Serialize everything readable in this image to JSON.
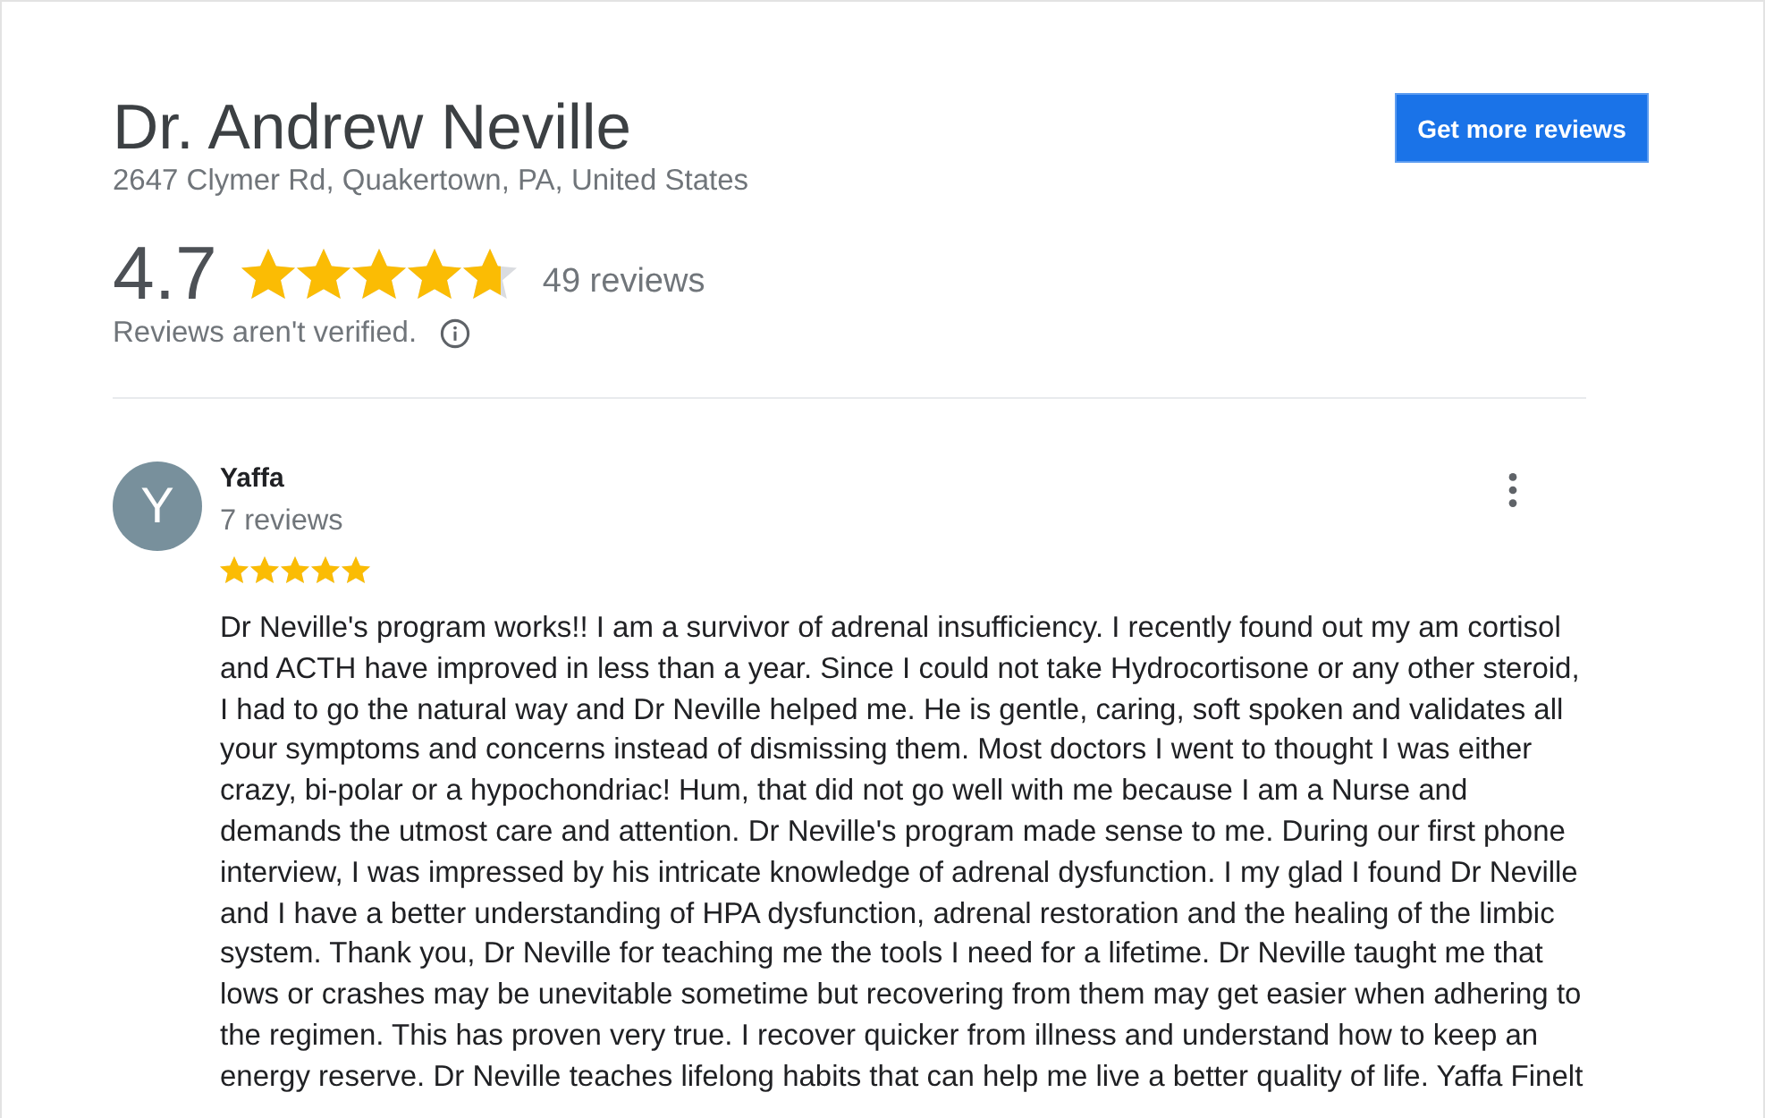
{
  "header": {
    "name": "Dr. Andrew Neville",
    "address": "2647 Clymer Rd, Quakertown, PA, United States",
    "button": "Get more reviews"
  },
  "rating": {
    "score": "4.7",
    "stars": 4.7,
    "count": "49 reviews",
    "note": "Reviews aren't verified."
  },
  "reviews": [
    {
      "avatar_letter": "Y",
      "name": "Yaffa",
      "review_count": "7 reviews",
      "stars": 5,
      "text": "Dr Neville's program works!! I am a survivor of adrenal insufficiency. I recently found out my am cortisol and ACTH have improved in less than a year. Since I could not take Hydrocortisone or any other steroid, I had to go the natural way and Dr Neville helped me. He is gentle, caring, soft spoken and validates all your symptoms and concerns instead of dismissing them. Most doctors I went to thought I was either crazy, bi-polar or a hypochondriac! Hum, that did not go well with me because I am a Nurse and demands the utmost care and attention. Dr Neville's program made sense to me. During our first phone interview, I was impressed by his intricate knowledge of adrenal dysfunction. I my glad I found Dr Neville and I have a better understanding of HPA dysfunction, adrenal restoration and the healing of the limbic system. Thank you, Dr Neville for teaching me the tools I need for a lifetime. Dr Neville taught me that lows or crashes may be unevitable sometime but recovering from them may get easier when adhering to the regimen. This has proven very true. I recover quicker from illness and understand how to keep an energy reserve. Dr Neville teaches lifelong habits that can help me live a better quality of life. Yaffa Finelt"
    }
  ]
}
